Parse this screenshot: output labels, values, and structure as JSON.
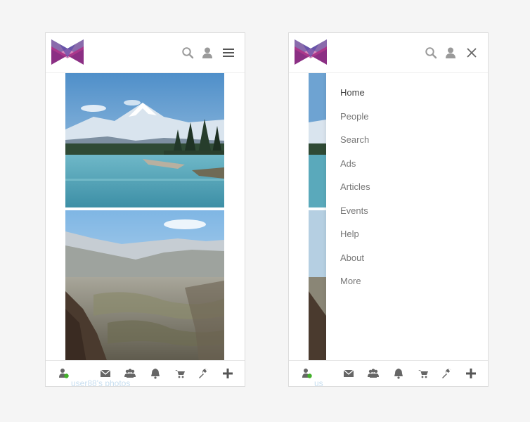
{
  "colors": {
    "accent_green": "#42b02a",
    "icon_gray": "#9a9a9a",
    "icon_dark": "#666666",
    "menu_text": "#777777",
    "logo_blue": "#3ab0d8",
    "logo_purple": "#8b2f84"
  },
  "left_screen": {
    "header_icons": [
      "search-icon",
      "user-icon",
      "hamburger-menu-icon"
    ],
    "photos": [
      "mountain-river-photo",
      "canyon-valley-photo"
    ],
    "caption": "user88's photos",
    "footer_icons": [
      "online-user-icon",
      "envelope-icon",
      "users-group-icon",
      "bell-icon",
      "cart-icon",
      "wrench-icon",
      "plus-icon"
    ]
  },
  "right_screen": {
    "header_icons": [
      "search-icon",
      "user-icon",
      "close-icon"
    ],
    "menu": {
      "items": [
        {
          "label": "Home",
          "active": true
        },
        {
          "label": "People"
        },
        {
          "label": "Search"
        },
        {
          "label": "Ads"
        },
        {
          "label": "Articles"
        },
        {
          "label": "Events"
        },
        {
          "label": "Help"
        },
        {
          "label": "About"
        },
        {
          "label": "More"
        }
      ]
    },
    "caption": "us",
    "footer_icons": [
      "online-user-icon",
      "envelope-icon",
      "users-group-icon",
      "bell-icon",
      "cart-icon",
      "wrench-icon",
      "plus-icon"
    ]
  }
}
